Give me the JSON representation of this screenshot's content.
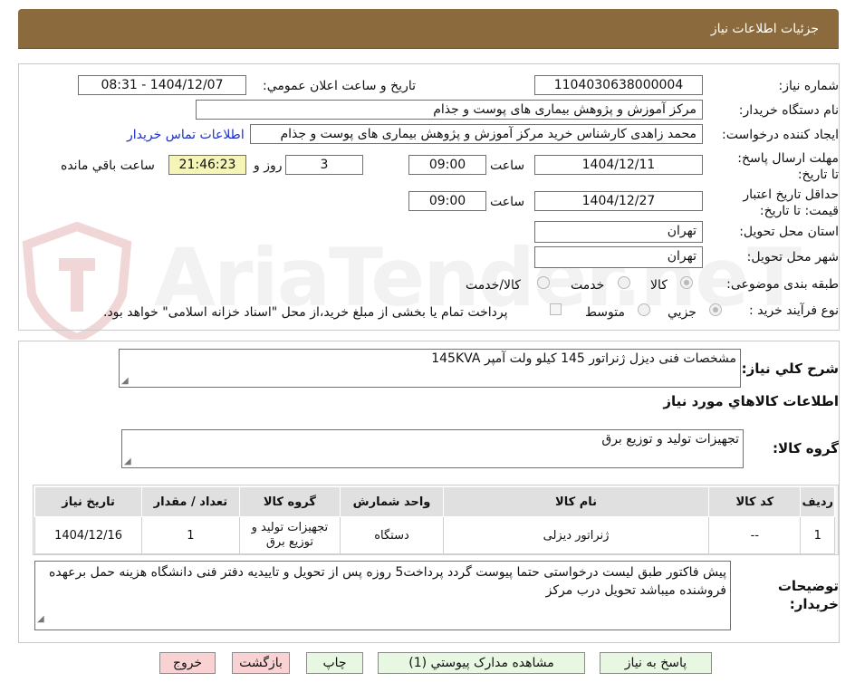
{
  "header": {
    "title": "جزئیات اطلاعات نیاز"
  },
  "watermark": {
    "text": "AriaTender.neT"
  },
  "form": {
    "need_number": {
      "label": "شماره نیاز:",
      "value": "1104030638000004"
    },
    "announce_datetime": {
      "label": "تاریخ و ساعت اعلان عمومي:",
      "value": "1404/12/07 - 08:31"
    },
    "buyer_org": {
      "label": "نام دستگاه خریدار:",
      "value": "مرکز آموزش و پژوهش بیماری های پوست و جذام"
    },
    "requester": {
      "label": "ایجاد کننده درخواست:",
      "value": "محمد زاهدی کارشناس خرید  مرکز آموزش و پژوهش بیماری های پوست و جذام",
      "contact_link": "اطلاعات تماس خریدار"
    },
    "reply_deadline": {
      "label": "مهلت ارسال پاسخ: تا تاریخ:",
      "date": "1404/12/11",
      "time_label": "ساعت",
      "time": "09:00",
      "days": "3",
      "days_label": "روز و",
      "remaining": "21:46:23",
      "remaining_label": "ساعت باقي مانده"
    },
    "price_validity": {
      "label": "حداقل تاریخ اعتبار قیمت: تا تاریخ:",
      "date": "1404/12/27",
      "time_label": "ساعت",
      "time": "09:00"
    },
    "delivery_province": {
      "label": "استان محل تحویل:",
      "value": "تهران"
    },
    "delivery_city": {
      "label": "شهر محل تحویل:",
      "value": "تهران"
    },
    "category": {
      "label": "طبقه بندی موضوعی:",
      "options": [
        "کالا",
        "خدمت",
        "کالا/خدمت"
      ],
      "selected": "کالا"
    },
    "purchase_type": {
      "label": "نوع فرآیند خرید :",
      "options": [
        "جزیي",
        "متوسط"
      ],
      "selected": "جزیي",
      "treasury_note": "پرداخت تمام یا بخشی از مبلغ خرید،از محل \"اسناد خزانه اسلامی\" خواهد بود."
    }
  },
  "summary": {
    "general_desc_label": "شرح کلي نیاز:",
    "general_desc": "مشخصات فنی دیزل  ژنراتور 145 کیلو ولت آمپر 145KVA",
    "goods_info_title": "اطلاعات کالاهاي مورد نیاز",
    "goods_group_label": "گروه کالا:",
    "goods_group": "تجهیزات تولید و توزیع برق"
  },
  "items_table": {
    "headers": [
      "ردیف",
      "کد کالا",
      "نام کالا",
      "واحد شمارش",
      "گروه کالا",
      "تعداد / مقدار",
      "تاریخ نیاز"
    ],
    "rows": [
      [
        "1",
        "--",
        "ژنراتور دیزلی",
        "دستگاه",
        "تجهیزات تولید و توزیع برق",
        "1",
        "1404/12/16"
      ]
    ]
  },
  "buyer_notes": {
    "label": "توضیحات خریدار:",
    "text": "پیش فاکتور طبق لیست درخواستی حتما پیوست گردد پرداخت5 روزه  پس از تحویل و تاییدیه دفتر فنی دانشگاه  هزینه حمل برعهده فروشنده میباشد تحویل درب مرکز"
  },
  "buttons": {
    "reply": "پاسخ به نیاز",
    "attachments": "مشاهده مدارک پیوستي (1)",
    "print": "چاپ",
    "back": "بازگشت",
    "exit": "خروج"
  },
  "colors": {
    "header_bg": "#8b6b3e",
    "remaining_bg": "#f5f5b8",
    "green_button": "#e8f7e1",
    "red_button": "#f9d3d3",
    "link": "#1a2fd0"
  }
}
